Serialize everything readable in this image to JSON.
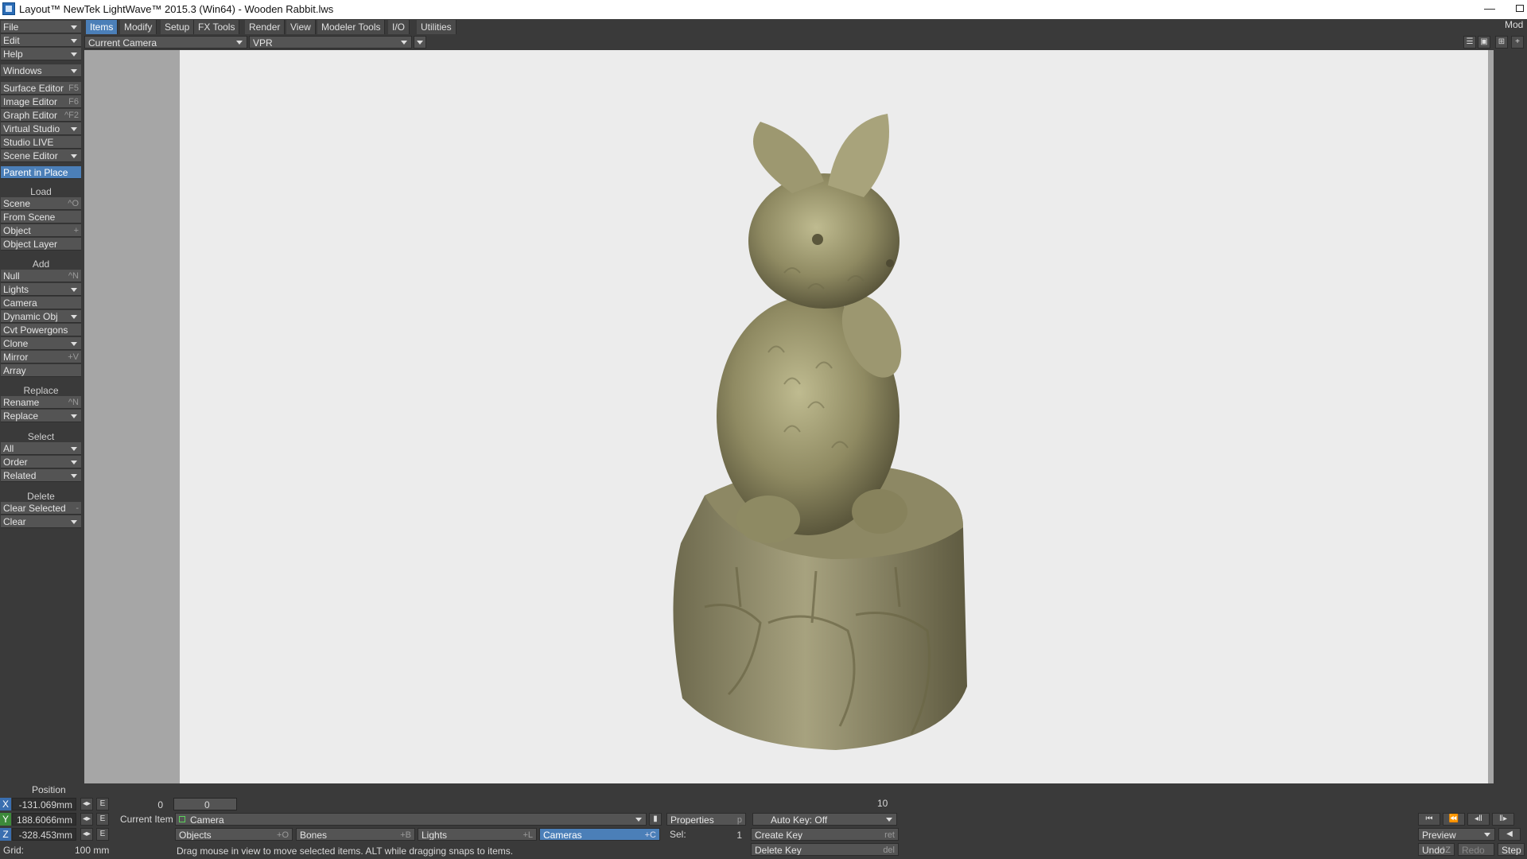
{
  "window": {
    "title": "Layout™ NewTek LightWave™ 2015.3 (Win64) - Wooden Rabbit.lws",
    "minimize": "—",
    "right_label": "Mod"
  },
  "colors": {
    "accent": "#4b7fb8",
    "panel": "#3a3a3a",
    "button": "#545454",
    "viewport_bg": "#ececec"
  },
  "sidebar": {
    "top_menus": [
      {
        "label": "File"
      },
      {
        "label": "Edit"
      },
      {
        "label": "Help"
      }
    ],
    "windows": {
      "label": "Windows"
    },
    "editors": [
      {
        "label": "Surface Editor",
        "shortcut": "F5"
      },
      {
        "label": "Image Editor",
        "shortcut": "F6"
      },
      {
        "label": "Graph Editor",
        "shortcut": "^F2"
      },
      {
        "label": "Virtual Studio",
        "shortcut": ""
      },
      {
        "label": "Studio LIVE",
        "shortcut": ""
      },
      {
        "label": "Scene Editor",
        "shortcut": ""
      }
    ],
    "parent_in_place": "Parent in Place",
    "load_header": "Load",
    "load": [
      {
        "label": "Scene",
        "shortcut": "^O"
      },
      {
        "label": "From Scene",
        "shortcut": ""
      },
      {
        "label": "Object",
        "shortcut": "+"
      },
      {
        "label": "Object Layer",
        "shortcut": ""
      }
    ],
    "add_header": "Add",
    "add": [
      {
        "label": "Null",
        "shortcut": "^N"
      },
      {
        "label": "Lights",
        "shortcut": ""
      },
      {
        "label": "Camera",
        "shortcut": ""
      },
      {
        "label": "Dynamic Obj",
        "shortcut": ""
      },
      {
        "label": "Cvt Powergons",
        "shortcut": ""
      },
      {
        "label": "Clone",
        "shortcut": ""
      },
      {
        "label": "Mirror",
        "shortcut": "+V"
      },
      {
        "label": "Array",
        "shortcut": ""
      }
    ],
    "replace_header": "Replace",
    "replace": [
      {
        "label": "Rename",
        "shortcut": "^N"
      },
      {
        "label": "Replace",
        "shortcut": ""
      }
    ],
    "select_header": "Select",
    "select": [
      {
        "label": "All"
      },
      {
        "label": "Order"
      },
      {
        "label": "Related"
      }
    ],
    "delete_header": "Delete",
    "delete": [
      {
        "label": "Clear Selected",
        "shortcut": "-"
      },
      {
        "label": "Clear",
        "shortcut": ""
      }
    ]
  },
  "tabs": [
    {
      "label": "Items",
      "active": true
    },
    {
      "label": "Modify"
    },
    {
      "label": "Setup"
    },
    {
      "label": "FX Tools"
    },
    {
      "label": "Render"
    },
    {
      "label": "View"
    },
    {
      "label": "Modeler Tools"
    },
    {
      "label": "I/O"
    },
    {
      "label": "Utilities"
    }
  ],
  "viewport_bar": {
    "camera_select": "Current Camera",
    "render_mode": "VPR"
  },
  "bottom": {
    "position_label": "Position",
    "x_label": "X",
    "x_value": "-131.069mm",
    "y_label": "Y",
    "y_value": "188.6066mm",
    "z_label": "Z",
    "z_value": "-328.453mm",
    "e_label": "E",
    "grid_label": "Grid:",
    "grid_value": "100 mm",
    "frame_start": "0",
    "frame_current": "0",
    "frame_ten": "10",
    "current_item_label": "Current Item",
    "current_item": "Camera",
    "properties": "Properties",
    "properties_sc": "p",
    "auto_key": "Auto Key: Off",
    "objects": "Objects",
    "objects_sc": "+O",
    "bones": "Bones",
    "bones_sc": "+B",
    "lights": "Lights",
    "lights_sc": "+L",
    "cameras": "Cameras",
    "cameras_sc": "+C",
    "sel_label": "Sel:",
    "sel_value": "1",
    "create_key": "Create Key",
    "create_key_sc": "ret",
    "delete_key": "Delete Key",
    "delete_key_sc": "del",
    "status": "Drag mouse in view to move selected items. ALT while dragging snaps to items.",
    "preview": "Preview",
    "undo": "Undo",
    "undo_sc": "^Z",
    "redo": "Redo",
    "step": "Step"
  }
}
